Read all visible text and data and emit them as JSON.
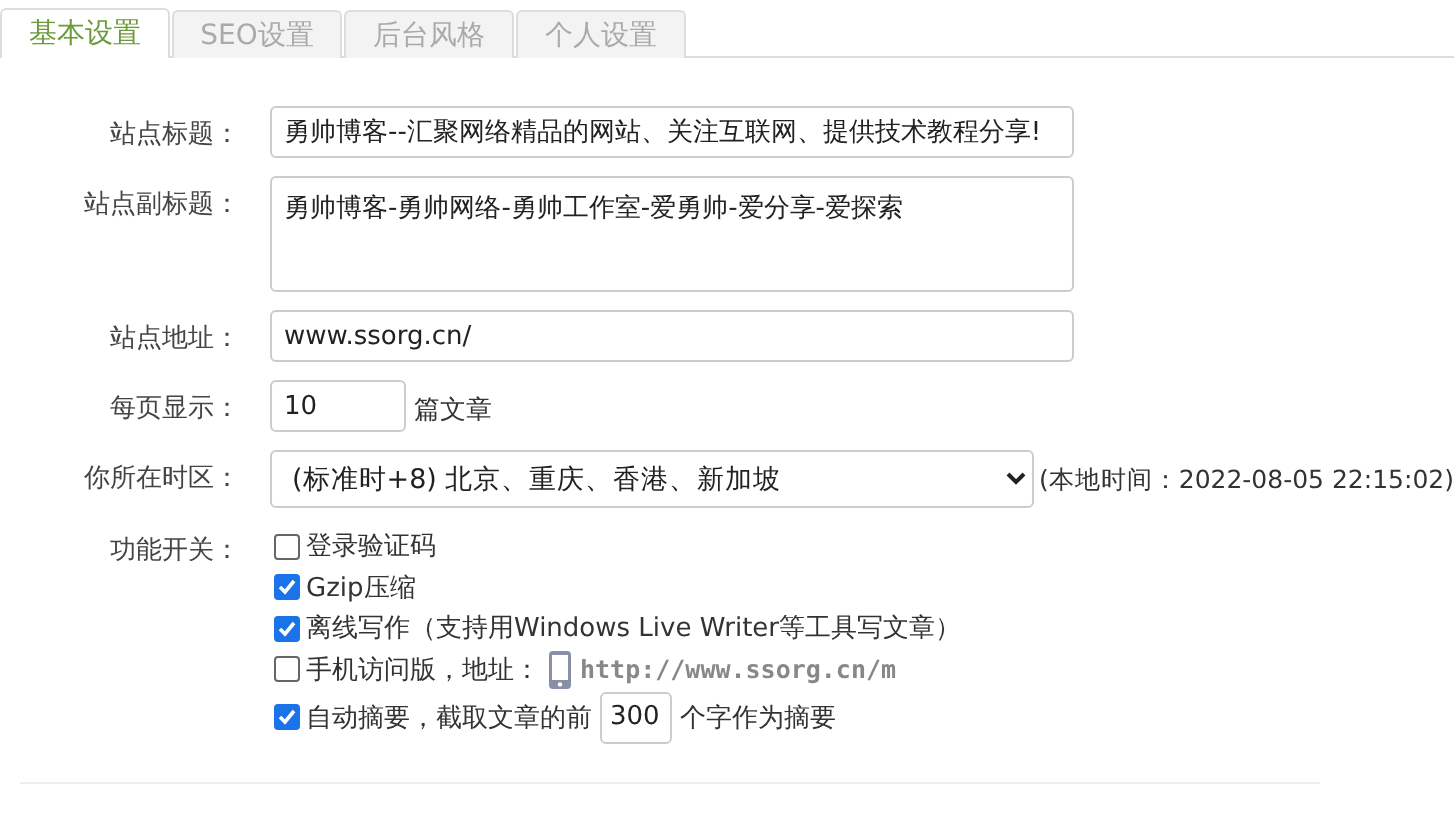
{
  "tabs": [
    {
      "label": "基本设置",
      "selected": true
    },
    {
      "label": "SEO设置",
      "selected": false
    },
    {
      "label": "后台风格",
      "selected": false
    },
    {
      "label": "个人设置",
      "selected": false
    }
  ],
  "fields": [
    {
      "kind": "text",
      "label": "站点标题：",
      "value": "勇帅博客--汇聚网络精品的网站、关注互联网、提供技术教程分享!"
    },
    {
      "kind": "textarea",
      "label": "站点副标题：",
      "value": "勇帅博客-勇帅网络-勇帅工作室-爱勇帅-爱分享-爱探索"
    },
    {
      "kind": "text",
      "label": "站点地址：",
      "value": "www.ssorg.cn/"
    },
    {
      "kind": "number",
      "label": "每页显示：",
      "value": "10",
      "suffix": "篇文章"
    },
    {
      "kind": "select",
      "label": "你所在时区：",
      "value": "(标准时+8) 北京、重庆、香港、新加坡",
      "note": "(本地时间：2022-08-05 22:15:02)"
    },
    {
      "kind": "checks",
      "label": "功能开关：",
      "options": [
        {
          "label": "登录验证码",
          "checked": false
        },
        {
          "label": "Gzip压缩",
          "checked": true
        },
        {
          "label": "离线写作（支持用Windows Live Writer等工具写文章）",
          "checked": true
        },
        {
          "label": "手机访问版，地址：",
          "checked": false,
          "url": "http://www.ssorg.cn/m"
        },
        {
          "label": "自动摘要，截取文章的前",
          "checked": true,
          "value": "300",
          "suffix": "个字作为摘要"
        }
      ]
    }
  ]
}
